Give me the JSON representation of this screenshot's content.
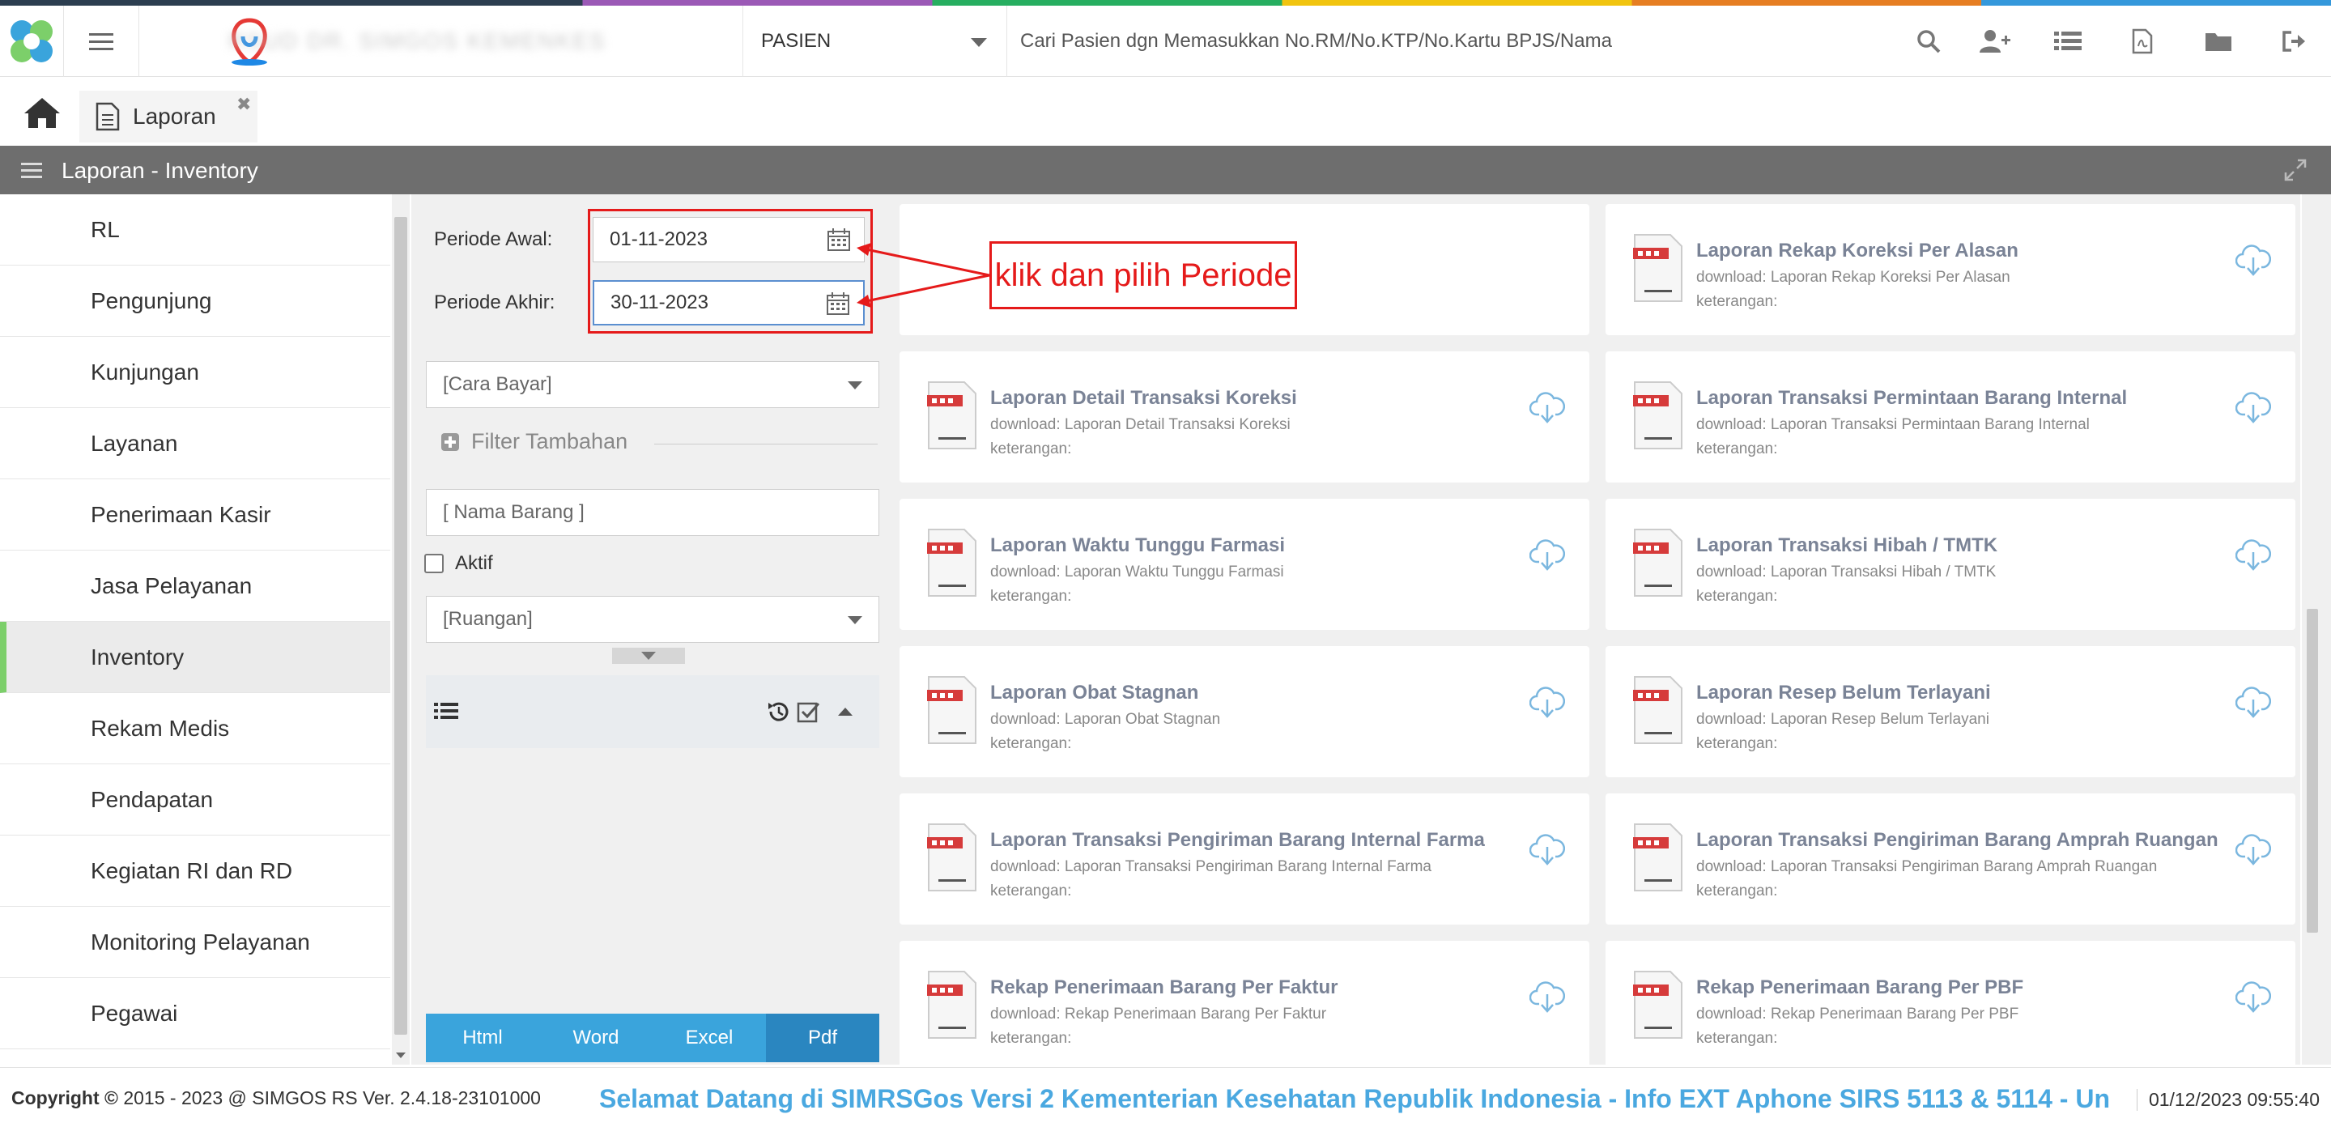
{
  "header": {
    "brand_name": "RSUD DR. SIMGOS KEMENKES",
    "patient_mode": "PASIEN",
    "search_placeholder": "Cari Pasien dgn Memasukkan No.RM/No.KTP/No.Kartu BPJS/Nama",
    "icons": [
      "search-icon",
      "add-user-icon",
      "list-icon",
      "pdf-icon",
      "folder-icon",
      "logout-icon"
    ]
  },
  "tabs": [
    {
      "label": "Laporan"
    }
  ],
  "titlebar": {
    "title": "Laporan - Inventory"
  },
  "sidebar": {
    "items": [
      {
        "label": "RL"
      },
      {
        "label": "Pengunjung"
      },
      {
        "label": "Kunjungan"
      },
      {
        "label": "Layanan"
      },
      {
        "label": "Penerimaan Kasir"
      },
      {
        "label": "Jasa Pelayanan"
      },
      {
        "label": "Inventory",
        "active": true
      },
      {
        "label": "Rekam Medis"
      },
      {
        "label": "Pendapatan"
      },
      {
        "label": "Kegiatan RI dan RD"
      },
      {
        "label": "Monitoring Pelayanan"
      },
      {
        "label": "Pegawai"
      }
    ]
  },
  "filter": {
    "periode_awal_label": "Periode Awal:",
    "periode_awal_value": "01-11-2023",
    "periode_akhir_label": "Periode Akhir:",
    "periode_akhir_value": "30-11-2023",
    "cara_bayar": "[Cara Bayar]",
    "filter_tambahan": "Filter Tambahan",
    "nama_barang_placeholder": "[ Nama Barang ]",
    "aktif_label": "Aktif",
    "ruangan": "[Ruangan]",
    "buttons": [
      "Html",
      "Word",
      "Excel",
      "Pdf"
    ]
  },
  "annotation": {
    "text": "klik dan pilih Periode",
    "color": "#e51a1a"
  },
  "reports": {
    "download_prefix": "download: ",
    "keterangan_label": "keterangan:",
    "left": [
      {
        "title": "",
        "download": ""
      },
      {
        "title": "Laporan Detail Transaksi Koreksi",
        "download": "Laporan Detail Transaksi Koreksi"
      },
      {
        "title": "Laporan Waktu Tunggu Farmasi",
        "download": "Laporan Waktu Tunggu Farmasi"
      },
      {
        "title": "Laporan Obat Stagnan",
        "download": "Laporan Obat Stagnan"
      },
      {
        "title": "Laporan Transaksi Pengiriman Barang Internal Farma",
        "download": "Laporan Transaksi Pengiriman Barang Internal Farma"
      },
      {
        "title": "Rekap Penerimaan Barang Per Faktur",
        "download": "Rekap Penerimaan Barang Per Faktur"
      }
    ],
    "right": [
      {
        "title": "Laporan Rekap Koreksi Per Alasan",
        "download": "Laporan Rekap Koreksi Per Alasan"
      },
      {
        "title": "Laporan Transaksi Permintaan Barang Internal",
        "download": "Laporan Transaksi Permintaan Barang Internal"
      },
      {
        "title": "Laporan Transaksi Hibah / TMTK",
        "download": "Laporan Transaksi Hibah / TMTK"
      },
      {
        "title": "Laporan Resep Belum Terlayani",
        "download": "Laporan Resep Belum Terlayani"
      },
      {
        "title": "Laporan Transaksi Pengiriman Barang Amprah Ruangan",
        "download": "Laporan Transaksi Pengiriman Barang Amprah Ruangan"
      },
      {
        "title": "Rekap Penerimaan Barang Per PBF",
        "download": "Rekap Penerimaan Barang Per PBF"
      }
    ]
  },
  "footer": {
    "copyright_label": "Copyright",
    "copyright_text": "2015 - 2023 @ SIMGOS RS Ver. 2.4.18-23101000",
    "marquee": "Selamat Datang di SIMRSGos Versi 2 Kementerian Kesehatan Republik Indonesia - Info EXT Aphone SIRS 5113 & 5114 - Un",
    "datetime": "01/12/2023 09:55:40"
  },
  "colors": {
    "accent": "#3aa4dc",
    "title_bar": "#6e6e6e",
    "active_indicator": "#7ccf6a",
    "annotation": "#e51a1a"
  }
}
